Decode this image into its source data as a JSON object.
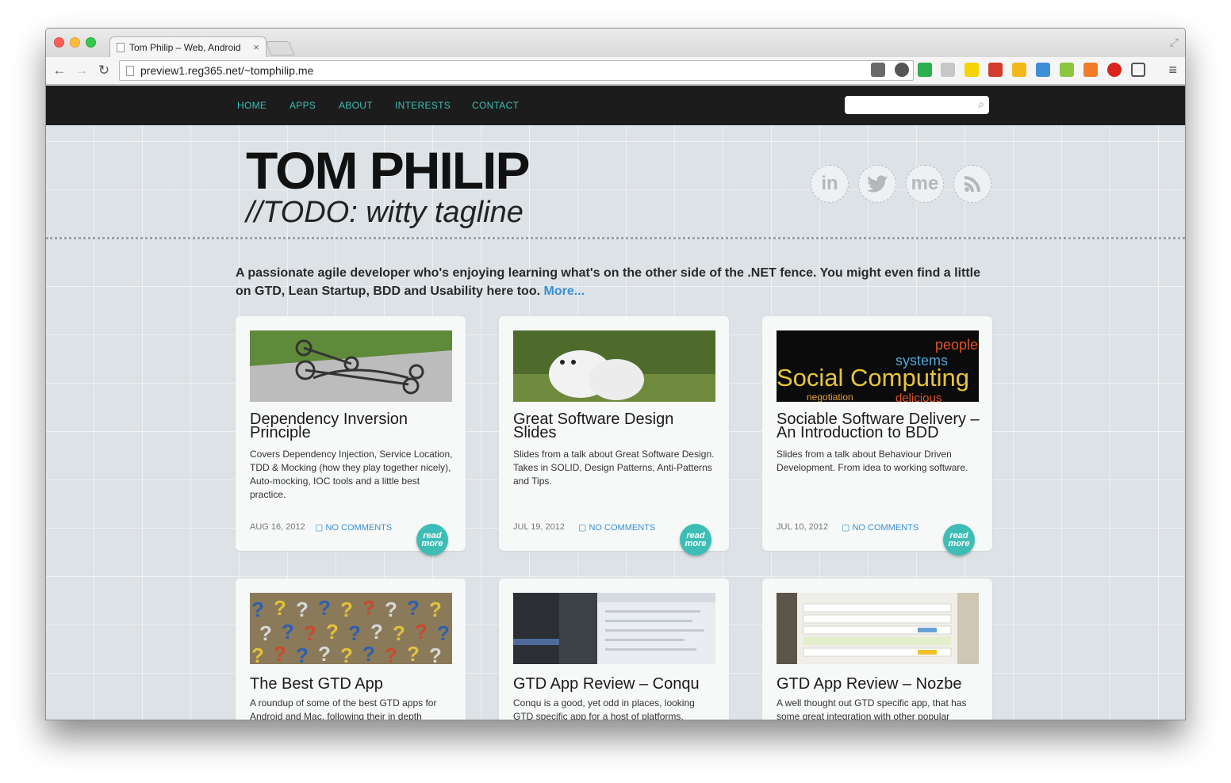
{
  "browser": {
    "tab_title": "Tom Philip – Web, Android",
    "tab_close": "×",
    "url": "preview1.reg365.net/~tomphilip.me"
  },
  "site": {
    "nav": [
      "HOME",
      "APPS",
      "ABOUT",
      "INTERESTS",
      "CONTACT"
    ],
    "title": "TOM PHILIP",
    "tagline": "//TODO: witty tagline",
    "social": [
      "in",
      "me"
    ],
    "intro": "A passionate agile developer who's enjoying learning what's on the other side of the .NET fence. You might even find a little on GTD, Lean Startup, BDD and Usability here too.",
    "intro_more": "More...",
    "read_more": "read more",
    "posts": [
      {
        "title": "Dependency Inversion Principle",
        "desc": "Covers Dependency Injection, Service Location, TDD & Mocking (how they play together nicely), Auto-mocking, IOC tools and a little best practice.",
        "date": "AUG 16, 2012",
        "comments": "NO COMMENTS"
      },
      {
        "title": "Great Software Design Slides",
        "desc": "Slides from a talk about Great Software Design. Takes in SOLID, Design Patterns, Anti-Patterns and Tips.",
        "date": "JUL 19, 2012",
        "comments": "NO COMMENTS"
      },
      {
        "title": "Sociable Software Delivery – An Introduction to BDD",
        "desc": "Slides from a talk about Behaviour Driven Development. From idea to working software.",
        "date": "JUL 10, 2012",
        "comments": "NO COMMENTS",
        "image_text": "Social Computing"
      },
      {
        "title": "The Best GTD App",
        "desc": "A roundup of some of the best GTD apps for Android and Mac, following their in depth"
      },
      {
        "title": "GTD App Review – Conqu",
        "desc": "Conqu is a good, yet odd in places, looking GTD specific app for a host of platforms,"
      },
      {
        "title": "GTD App Review – Nozbe",
        "desc": "A well thought out GTD specific app, that has some great integration with other popular"
      }
    ]
  }
}
